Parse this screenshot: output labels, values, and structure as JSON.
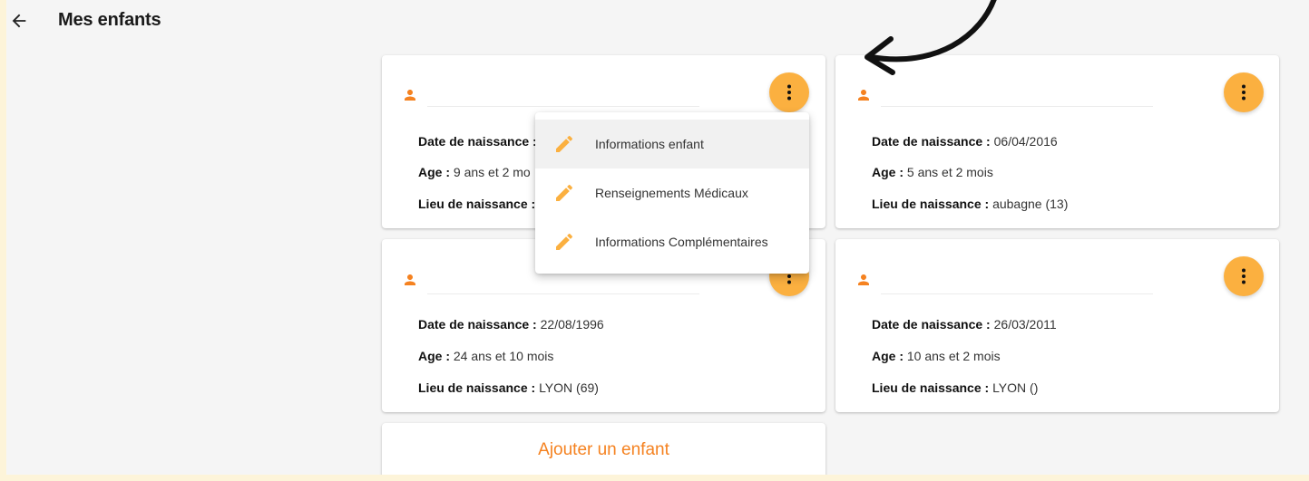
{
  "header": {
    "title": "Mes enfants"
  },
  "children": [
    {
      "birth_label": "Date de naissance :",
      "birth_date": "",
      "age_label": "Age :",
      "age": "9 ans et 2 mo",
      "place_label": "Lieu de naissance :",
      "place": ""
    },
    {
      "birth_label": "Date de naissance :",
      "birth_date": "06/04/2016",
      "age_label": "Age :",
      "age": "5 ans et 2 mois",
      "place_label": "Lieu de naissance :",
      "place": "aubagne (13)"
    },
    {
      "birth_label": "Date de naissance :",
      "birth_date": "22/08/1996",
      "age_label": "Age :",
      "age": "24 ans et 10 mois",
      "place_label": "Lieu de naissance :",
      "place": "LYON (69)"
    },
    {
      "birth_label": "Date de naissance :",
      "birth_date": "26/03/2011",
      "age_label": "Age :",
      "age": "10 ans et 2 mois",
      "place_label": "Lieu de naissance :",
      "place": "LYON ()"
    }
  ],
  "add_child": {
    "label": "Ajouter un enfant"
  },
  "menu": {
    "items": [
      {
        "label": "Informations enfant",
        "icon": "pencil-icon",
        "active": true
      },
      {
        "label": "Renseignements Médicaux",
        "icon": "pencil-icon"
      },
      {
        "label": "Informations Complémentaires",
        "icon": "pencil-icon"
      }
    ]
  },
  "colors": {
    "accent": "#f58220",
    "kebab": "#fbb040",
    "frame": "#fdf4d9",
    "background": "#f5f5f5"
  }
}
